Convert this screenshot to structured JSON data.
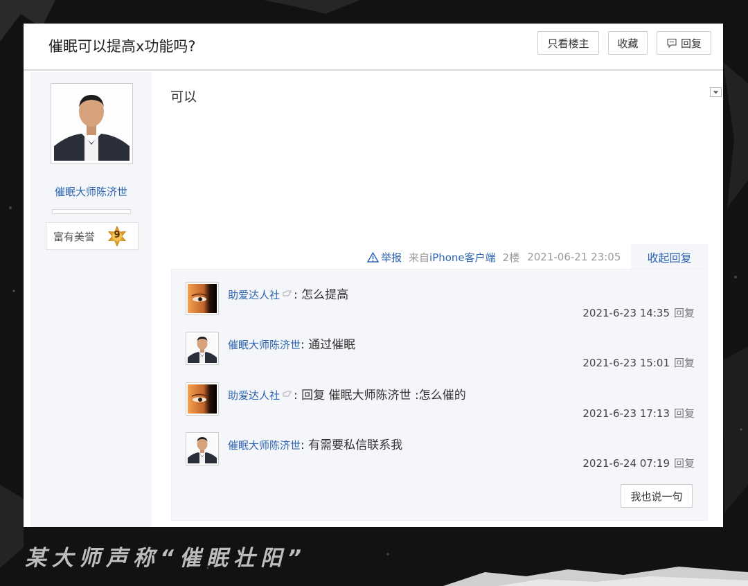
{
  "post": {
    "title": "催眠可以提高x功能吗?",
    "buttons": {
      "only_op": "只看楼主",
      "favorite": "收藏",
      "reply": "回复"
    },
    "author": {
      "name": "催眠大师陈济世",
      "honor": "富有美誉",
      "level": "9"
    },
    "content": "可以",
    "meta": {
      "report": "举报",
      "source_prefix": "来自",
      "source_device": "iPhone客户端",
      "floor": "2楼",
      "datetime": "2021-06-21 23:05",
      "collapse_label": "收起回复"
    }
  },
  "replies": [
    {
      "user": "助爱达人社",
      "has_hand": true,
      "sep": ":",
      "text": " 怎么提高",
      "time": "2021-6-23 14:35",
      "reply_label": "回复",
      "avatar": "eye-avatar"
    },
    {
      "user": "催眠大师陈济世",
      "has_hand": false,
      "sep": ":",
      "text": " 通过催眠",
      "time": "2021-6-23 15:01",
      "reply_label": "回复",
      "avatar": "man-avatar"
    },
    {
      "user": "助爱达人社",
      "has_hand": true,
      "sep": ":",
      "text": " 回复 催眠大师陈济世 :怎么催的",
      "time": "2021-6-23 17:13",
      "reply_label": "回复",
      "avatar": "eye-avatar"
    },
    {
      "user": "催眠大师陈济世",
      "has_hand": false,
      "sep": ":",
      "text": " 有需要私信联系我",
      "time": "2021-6-24 07:19",
      "reply_label": "回复",
      "avatar": "man-avatar"
    }
  ],
  "say_button": "我也说一句",
  "caption": "某大师声称“催眠壮阳”",
  "colors": {
    "link_blue": "#2d64b3",
    "panel_bg": "#f4f6f9",
    "page_bg": "#111111",
    "badge_gold": "#e3a22a"
  }
}
